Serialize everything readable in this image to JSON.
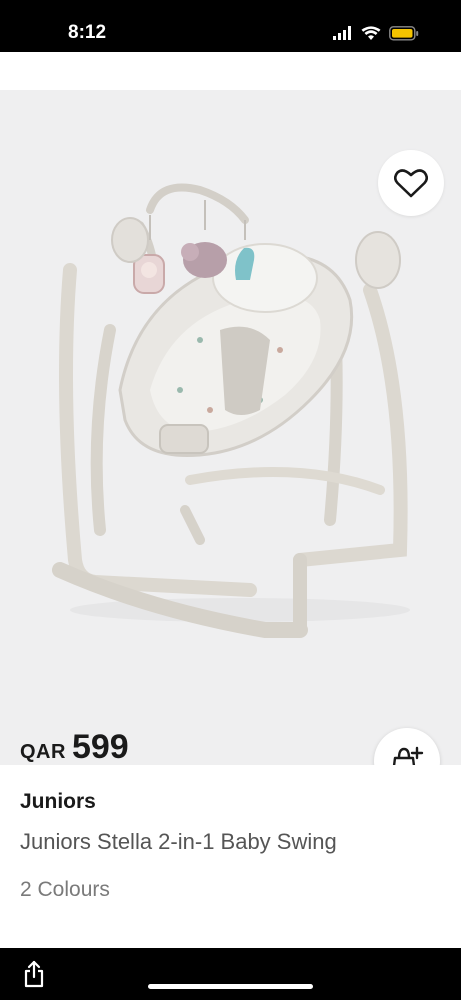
{
  "status_bar": {
    "time": "8:12",
    "icons": [
      "signal-icon",
      "wifi-icon",
      "battery-icon"
    ],
    "battery_color": "#f5c400"
  },
  "product": {
    "image_icon": "baby-swing-image",
    "currency": "QAR",
    "price": "599",
    "brand": "Juniors",
    "name": "Juniors Stella 2-in-1 Baby Swing",
    "colours": "2 Colours"
  },
  "actions": {
    "favorite_icon": "heart-icon",
    "add_to_bag_icon": "bag-plus-icon",
    "share_icon": "share-icon"
  },
  "colors": {
    "image_background": "#efeff0",
    "text_primary": "#1a1a1a",
    "text_secondary": "#555555"
  }
}
